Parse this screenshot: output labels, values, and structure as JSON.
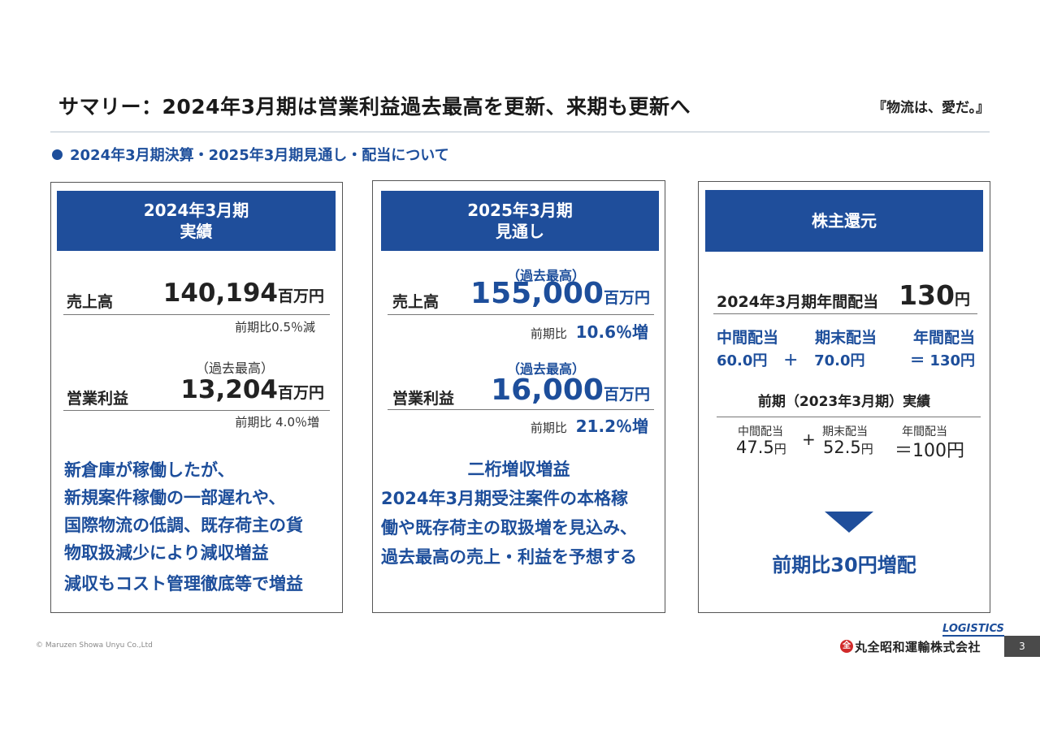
{
  "header": {
    "title": "サマリー：2024年3月期は営業利益過去最高を更新、来期も更新へ",
    "tagline": "『物流は、愛だ。』"
  },
  "subheading": "2024年3月期決算・2025年3月期見通し・配当について",
  "panel1": {
    "head_line1": "2024年3月期",
    "head_line2": "実績",
    "sales_label": "売上高",
    "sales_value": "140,194",
    "sales_unit": "百万円",
    "sales_yoy": "前期比0.5％減",
    "op_note": "（過去最高）",
    "op_label": "営業利益",
    "op_value": "13,204",
    "op_unit": "百万円",
    "op_yoy": "前期比 4.0％増",
    "comment_lines": [
      "新倉庫が稼働したが、",
      "新規案件稼働の一部遅れや、",
      "国際物流の低調、既存荷主の貨",
      "物取扱減少により減収増益"
    ],
    "comment_last": "減収もコスト管理徹底等で増益"
  },
  "panel2": {
    "head_line1": "2025年3月期",
    "head_line2": "見通し",
    "sales_note": "（過去最高）",
    "sales_label": "売上高",
    "sales_value": "155,000",
    "sales_unit": "百万円",
    "sales_yoy_label": "前期比",
    "sales_yoy_value": "10.6％増",
    "op_note": "（過去最高）",
    "op_label": "営業利益",
    "op_value": "16,000",
    "op_unit": "百万円",
    "op_yoy_label": "前期比",
    "op_yoy_value": "21.2％増",
    "headline": "二桁増収増益",
    "comment_lines": [
      "2024年3月期受注案件の本格稼",
      "働や既存荷主の取扱増を見込み、",
      "過去最高の売上・利益を予想する"
    ]
  },
  "panel3": {
    "head": "株主還元",
    "annual_label": "2024年3月期年間配当",
    "annual_value": "130",
    "annual_unit": "円",
    "interim_label": "中間配当",
    "yearend_label": "期末配当",
    "total_label": "年間配当",
    "interim_value": "60.0円",
    "plus": "＋",
    "yearend_value": "70.0円",
    "total_value": "＝ 130円",
    "prev_label": "前期（2023年3月期）実績",
    "prev_interim_label": "中間配当",
    "prev_yearend_label": "期末配当",
    "prev_total_label": "年間配当",
    "prev_interim_num": "47.5",
    "prev_interim_unit": "円",
    "prev_plus": "+",
    "prev_yearend_num": "52.5",
    "prev_yearend_unit": "円",
    "prev_total": "＝100円",
    "conclusion": "前期比30円増配"
  },
  "footer": {
    "copyright": "© Maruzen Showa Unyu Co.,Ltd",
    "logo_text": "LOGISTICS",
    "company": "丸全昭和運輸株式会社",
    "page_number": "3"
  },
  "colors": {
    "accent": "#1f4e9b",
    "text_blue": "#1d4e9b"
  }
}
